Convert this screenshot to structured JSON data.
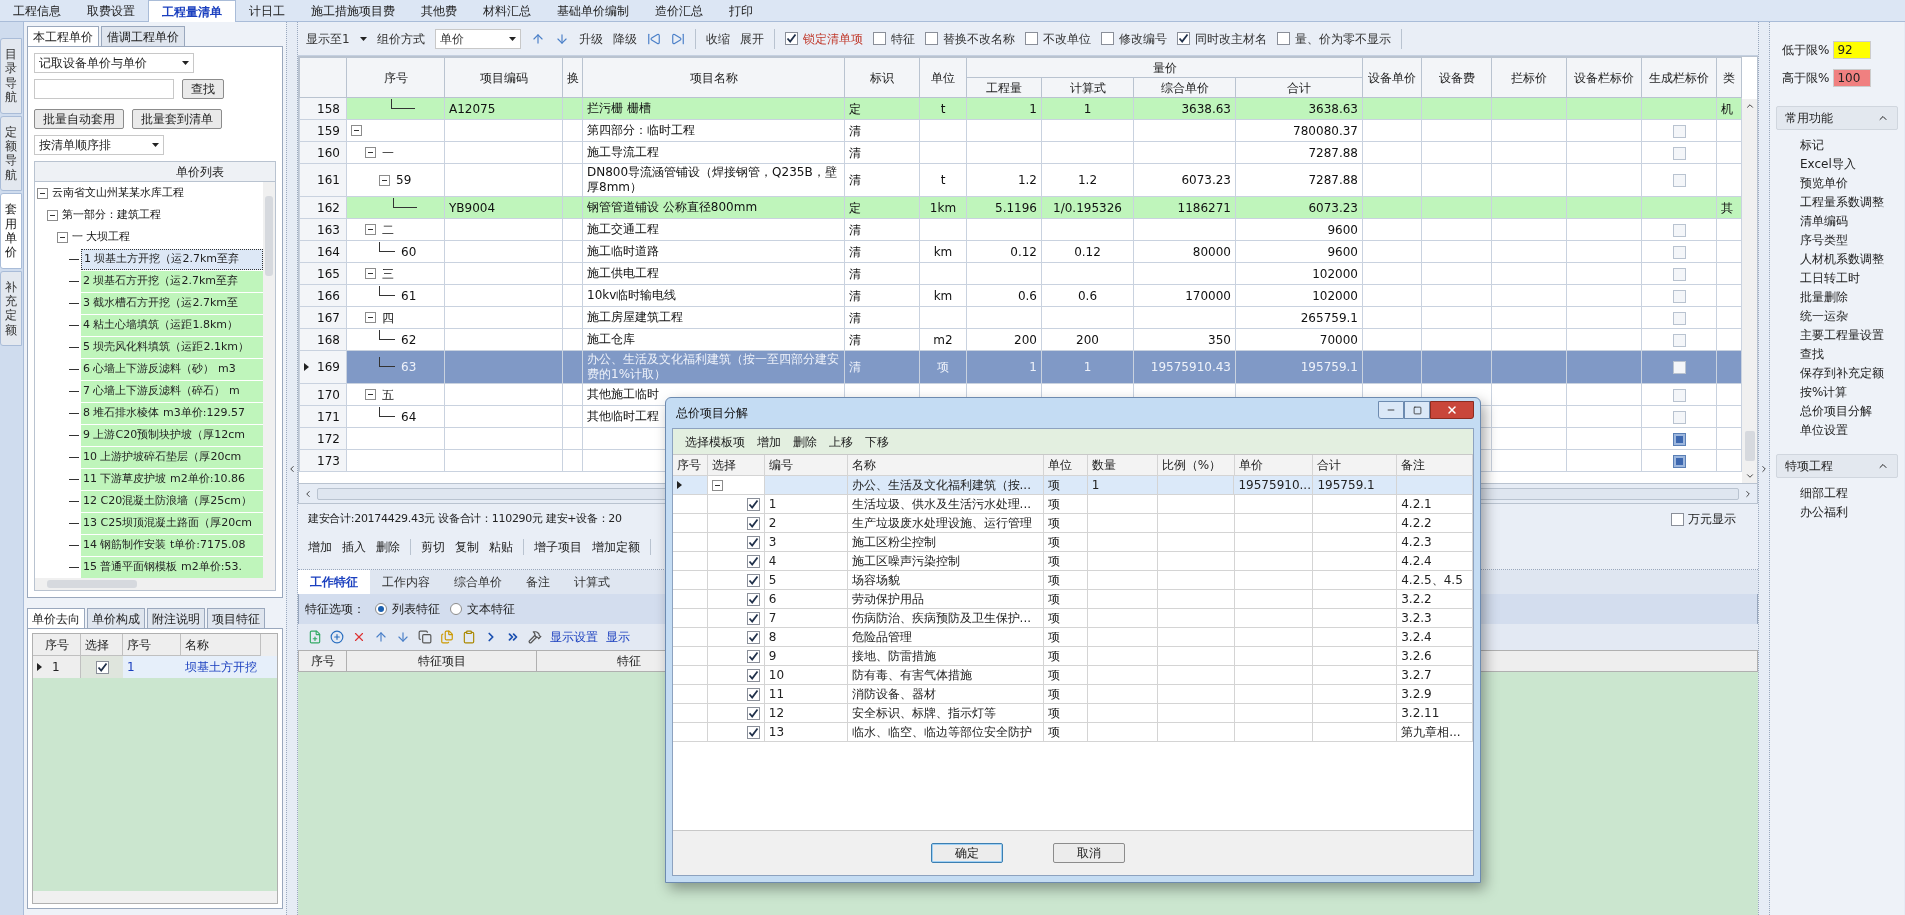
{
  "menu_tabs": [
    {
      "label": "工程信息",
      "selected": false
    },
    {
      "label": "取费设置",
      "selected": false
    },
    {
      "label": "工程量清单",
      "selected": true
    },
    {
      "label": "计日工",
      "selected": false
    },
    {
      "label": "施工措施项目费",
      "selected": false
    },
    {
      "label": "其他费",
      "selected": false
    },
    {
      "label": "材料汇总",
      "selected": false
    },
    {
      "label": "基础单价编制",
      "selected": false
    },
    {
      "label": "造价汇总",
      "selected": false
    },
    {
      "label": "打印",
      "selected": false
    }
  ],
  "side_nav": [
    {
      "label": "目录导航",
      "selected": false
    },
    {
      "label": "定额导航",
      "selected": false
    },
    {
      "label": "套用单价",
      "selected": true
    },
    {
      "label": "补充定额",
      "selected": false
    }
  ],
  "left_panel": {
    "tabs": [
      {
        "label": "本工程单价",
        "selected": true
      },
      {
        "label": "借调工程单价",
        "selected": false
      }
    ],
    "mode_select": "记取设备单价与单价",
    "search_button": "查找",
    "buttons": [
      "批量自动套用",
      "批量套到清单"
    ],
    "sort_select": "按清单顺序排",
    "tree_title": "单价列表",
    "tree": [
      {
        "label": "云南省文山州某某水库工程",
        "expanded": true,
        "children": [
          {
            "label": "第一部分：建筑工程",
            "expanded": true,
            "children": [
              {
                "label": "一 大坝工程",
                "expanded": true,
                "children": [
                  {
                    "label": "1 坝基土方开挖（运2.7km至弃",
                    "selected": true
                  },
                  {
                    "label": "2 坝基石方开挖（运2.7km至弃",
                    "selected": false
                  },
                  {
                    "label": "3 截水槽石方开挖（运2.7km至",
                    "selected": false
                  },
                  {
                    "label": "4 粘土心墙填筑（运距1.8km）",
                    "selected": false
                  },
                  {
                    "label": "5 坝壳风化料填筑（运距2.1km）",
                    "selected": false
                  },
                  {
                    "label": "6 心墙上下游反滤料（砂） m3",
                    "selected": false
                  },
                  {
                    "label": "7 心墙上下游反滤料（碎石） m",
                    "selected": false
                  },
                  {
                    "label": "8 堆石排水棱体 m3单价:129.57",
                    "selected": false
                  },
                  {
                    "label": "9 上游C20预制块护坡（厚12cm",
                    "selected": false
                  },
                  {
                    "label": "10 上游护坡碎石垫层（厚20cm",
                    "selected": false
                  },
                  {
                    "label": "11 下游草皮护坡 m2单价:10.86",
                    "selected": false
                  },
                  {
                    "label": "12 C20混凝土防浪墙（厚25cm）",
                    "selected": false
                  },
                  {
                    "label": "13 C25坝顶混凝土路面（厚20cm",
                    "selected": false
                  },
                  {
                    "label": "14 钢筋制作安装 t单价:7175.08",
                    "selected": false
                  },
                  {
                    "label": "15 普通平面钢模板 m2单价:53.",
                    "selected": false
                  }
                ]
              }
            ]
          }
        ]
      }
    ],
    "bottom_tabs": [
      {
        "label": "单价去向",
        "selected": true
      },
      {
        "label": "单价构成",
        "selected": false
      },
      {
        "label": "附注说明",
        "selected": false
      },
      {
        "label": "项目特征",
        "selected": false
      }
    ],
    "grid": {
      "columns": [
        "序号",
        "选择",
        "序号",
        "名称"
      ],
      "rows": [
        {
          "row": "1",
          "checked": true,
          "no": "1",
          "name": "坝基土方开挖",
          "current": true
        }
      ]
    }
  },
  "toolbar": {
    "display_level": "显示至1",
    "pricing_label": "组价方式",
    "pricing_select": "单价",
    "level_actions": [
      "升级",
      "降级"
    ],
    "fold_actions": [
      "收缩",
      "展开"
    ],
    "options": [
      {
        "label": "锁定清单项",
        "checked": true,
        "highlighted": true
      },
      {
        "label": "特征",
        "checked": false,
        "highlighted": false
      },
      {
        "label": "替换不改名称",
        "checked": false,
        "highlighted": false
      },
      {
        "label": "不改单位",
        "checked": false,
        "highlighted": false
      },
      {
        "label": "修改编号",
        "checked": false,
        "highlighted": false
      },
      {
        "label": "同时改主材名",
        "checked": true,
        "highlighted": false
      },
      {
        "label": "量、价为零不显示",
        "checked": false,
        "highlighted": false
      }
    ]
  },
  "table": {
    "header_left": [
      "序号",
      "项目编码",
      "换",
      "项目名称",
      "标识",
      "单位"
    ],
    "group_header": "量价",
    "group_columns": [
      "工程量",
      "计算式",
      "综合单价",
      "合计"
    ],
    "header_right": [
      "设备单价",
      "设备费",
      "拦标价",
      "设备栏标价",
      "生成栏标价",
      "类"
    ],
    "rows": [
      {
        "row": "158",
        "kind": "quota",
        "selected": false,
        "code": "A12075",
        "name": "拦污栅 栅槽",
        "flag": "定",
        "unit": "t",
        "qty": "1",
        "formula": "1",
        "unit_price": "3638.63",
        "total": "3638.63",
        "cat": "机"
      },
      {
        "row": "159",
        "kind": "group",
        "selected": false,
        "expanded": true,
        "name": "第四部分：临时工程",
        "flag": "清",
        "total": "780080.37",
        "generate": false,
        "children": [
          {
            "row": "160",
            "kind": "group",
            "selected": false,
            "expanded": true,
            "seq": "一",
            "name": "施工导流工程",
            "flag": "清",
            "total": "7287.88",
            "generate": false,
            "children": [
              {
                "row": "161",
                "kind": "group",
                "selected": false,
                "expanded": true,
                "seq": "59",
                "name": "DN800导流涵管铺设（焊接钢管，Q235B，壁厚8mm）",
                "flag": "清",
                "unit": "t",
                "qty": "1.2",
                "formula": "1.2",
                "unit_price": "6073.23",
                "total": "7287.88",
                "generate": false,
                "children": [
                  {
                    "row": "162",
                    "kind": "quota",
                    "selected": false,
                    "code": "YB9004",
                    "name": "钢管管道铺设 公称直径800mm",
                    "flag": "定",
                    "unit": "1km",
                    "qty": "5.1196",
                    "formula": "1/0.195326",
                    "unit_price": "1186271",
                    "total": "6073.23",
                    "cat": "其"
                  }
                ]
              }
            ]
          },
          {
            "row": "163",
            "kind": "group",
            "selected": false,
            "expanded": true,
            "seq": "二",
            "name": "施工交通工程",
            "flag": "清",
            "total": "9600",
            "generate": false,
            "children": [
              {
                "row": "164",
                "kind": "item",
                "selected": false,
                "seq": "60",
                "name": "施工临时道路",
                "flag": "清",
                "unit": "km",
                "qty": "0.12",
                "formula": "0.12",
                "unit_price": "80000",
                "total": "9600",
                "generate": false
              }
            ]
          },
          {
            "row": "165",
            "kind": "group",
            "selected": false,
            "expanded": true,
            "seq": "三",
            "name": "施工供电工程",
            "flag": "清",
            "total": "102000",
            "generate": false,
            "children": [
              {
                "row": "166",
                "kind": "item",
                "selected": false,
                "seq": "61",
                "name": "10kv临时输电线",
                "flag": "清",
                "unit": "km",
                "qty": "0.6",
                "formula": "0.6",
                "unit_price": "170000",
                "total": "102000",
                "generate": false
              }
            ]
          },
          {
            "row": "167",
            "kind": "group",
            "selected": false,
            "expanded": true,
            "seq": "四",
            "name": "施工房屋建筑工程",
            "flag": "清",
            "total": "265759.1",
            "generate": false,
            "children": [
              {
                "row": "168",
                "kind": "item",
                "selected": false,
                "seq": "62",
                "name": "施工仓库",
                "flag": "清",
                "unit": "m2",
                "qty": "200",
                "formula": "200",
                "unit_price": "350",
                "total": "70000",
                "generate": false
              },
              {
                "row": "169",
                "kind": "item",
                "selected": true,
                "seq": "63",
                "name": "办公、生活及文化福利建筑（按一至四部分建安费的1%计取）",
                "flag": "清",
                "unit": "项",
                "qty": "1",
                "formula": "1",
                "unit_price": "19575910.43",
                "total": "195759.1",
                "generate": false
              }
            ]
          },
          {
            "row": "170",
            "kind": "group",
            "selected": false,
            "expanded": true,
            "seq": "五",
            "name": "其他施工临时",
            "generate": false,
            "children": [
              {
                "row": "171",
                "kind": "item",
                "selected": false,
                "seq": "64",
                "name": "其他临时工程",
                "generate": false
              }
            ]
          }
        ]
      },
      {
        "row": "172",
        "kind": "empty",
        "selected": false,
        "generate": true
      },
      {
        "row": "173",
        "kind": "empty",
        "selected": false,
        "generate": true
      }
    ]
  },
  "summary": "建安合计:20174429.43元 设备合计：110290元 建安+设备：20",
  "wan_yuan": {
    "label": "万元显示",
    "checked": false
  },
  "actions": [
    [
      "增加",
      "插入",
      "删除"
    ],
    [
      "剪切",
      "复制",
      "粘贴"
    ],
    [
      "增子项目",
      "增加定额"
    ]
  ],
  "detail_tabs": [
    {
      "label": "工作特征",
      "selected": true
    },
    {
      "label": "工作内容",
      "selected": false
    },
    {
      "label": "综合单价",
      "selected": false
    },
    {
      "label": "备注",
      "selected": false
    },
    {
      "label": "计算式",
      "selected": false
    }
  ],
  "feature_option": {
    "label": "特征选项：",
    "choices": [
      {
        "label": "列表特征",
        "selected": true
      },
      {
        "label": "文本特征",
        "selected": false
      }
    ]
  },
  "feature_toolbar": {
    "buttons": [
      "显示设置",
      "显示"
    ]
  },
  "feature_grid": {
    "columns": [
      "序号",
      "特征项目",
      "特征"
    ]
  },
  "right_panel": {
    "limits": [
      {
        "label": "低于限%",
        "value": "92",
        "color": "#ffff00"
      },
      {
        "label": "高于限%",
        "value": "100",
        "color": "#f08080"
      }
    ],
    "sections": [
      {
        "title": "常用功能",
        "expanded": true,
        "items": [
          "标记",
          "Excel导入",
          "预览单价",
          "工程量系数调整",
          "清单编码",
          "序号类型",
          "人材机系数调整",
          "工日转工时",
          "批量删除",
          "统一运杂",
          "主要工程量设置",
          "查找",
          "保存到补充定额",
          "按%计算",
          "总价项目分解",
          "单位设置"
        ]
      },
      {
        "title": "特项工程",
        "expanded": true,
        "items": [
          "细部工程",
          "办公福利"
        ]
      }
    ]
  },
  "dialog": {
    "title": "总价项目分解",
    "toolbar": [
      "选择模板项",
      "增加",
      "删除",
      "上移",
      "下移"
    ],
    "columns": [
      "序号",
      "选择",
      "编号",
      "名称",
      "单位",
      "数量",
      "比例（%）",
      "单价",
      "合计",
      "备注"
    ],
    "rows": [
      {
        "name": "办公、生活及文化福利建筑（按...",
        "unit": "项",
        "qty": "1",
        "price": "19575910...",
        "total": "195759.1",
        "expanded": true,
        "current": true,
        "children": [
          {
            "no": "1",
            "checked": true,
            "name": "生活垃圾、供水及生活污水处理...",
            "unit": "项",
            "note": "4.2.1"
          },
          {
            "no": "2",
            "checked": true,
            "name": "生产垃圾废水处理设施、运行管理",
            "unit": "项",
            "note": "4.2.2"
          },
          {
            "no": "3",
            "checked": true,
            "name": "施工区粉尘控制",
            "unit": "项",
            "note": "4.2.3"
          },
          {
            "no": "4",
            "checked": true,
            "name": "施工区噪声污染控制",
            "unit": "项",
            "note": "4.2.4"
          },
          {
            "no": "5",
            "checked": true,
            "name": "场容场貌",
            "unit": "项",
            "note": "4.2.5、4.5"
          },
          {
            "no": "6",
            "checked": true,
            "name": "劳动保护用品",
            "unit": "项",
            "note": "3.2.2"
          },
          {
            "no": "7",
            "checked": true,
            "name": "伤病防治、疾病预防及卫生保护...",
            "unit": "项",
            "note": "3.2.3"
          },
          {
            "no": "8",
            "checked": true,
            "name": "危险品管理",
            "unit": "项",
            "note": "3.2.4"
          },
          {
            "no": "9",
            "checked": true,
            "name": "接地、防雷措施",
            "unit": "项",
            "note": "3.2.6"
          },
          {
            "no": "10",
            "checked": true,
            "name": "防有毒、有害气体措施",
            "unit": "项",
            "note": "3.2.7"
          },
          {
            "no": "11",
            "checked": true,
            "name": "消防设备、器材",
            "unit": "项",
            "note": "3.2.9"
          },
          {
            "no": "12",
            "checked": true,
            "name": "安全标识、标牌、指示灯等",
            "unit": "项",
            "note": "3.2.11"
          },
          {
            "no": "13",
            "checked": true,
            "name": "临水、临空、临边等部位安全防护",
            "unit": "项",
            "note": "第九章相..."
          }
        ]
      }
    ],
    "buttons": [
      {
        "label": "确定",
        "kind": "primary"
      },
      {
        "label": "取消",
        "kind": "secondary"
      }
    ]
  }
}
